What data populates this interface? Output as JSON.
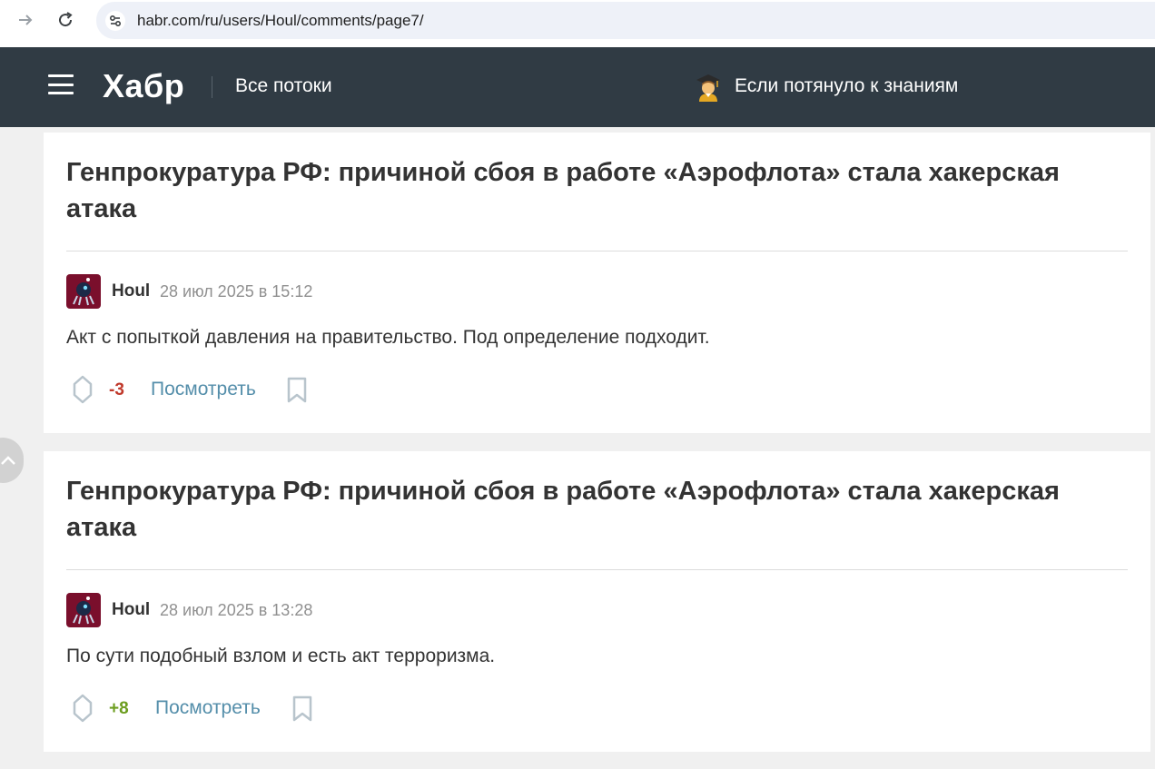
{
  "browser": {
    "url": "habr.com/ru/users/Houl/comments/page7/"
  },
  "header": {
    "logo": "Хабр",
    "streams_label": "Все потоки",
    "promo_text": "Если потянуло к знаниям"
  },
  "comments": [
    {
      "article_title": "Генпрокуратура РФ: причиной сбоя в работе «Аэрофлота» стала хакерская атака",
      "author": "Houl",
      "date": "28 июл 2025 в 15:12",
      "text": "Акт с попыткой давления на правительство. Под определение подходит.",
      "score": "-3",
      "view_label": "Посмотреть"
    },
    {
      "article_title": "Генпрокуратура РФ: причиной сбоя в работе «Аэрофлота» стала хакерская атака",
      "author": "Houl",
      "date": "28 июл 2025 в 13:28",
      "text": "По сути подобный взлом и есть акт терроризма.",
      "score": "+8",
      "view_label": "Посмотреть"
    }
  ],
  "colors": {
    "header_bg": "#303b44",
    "score_negative": "#c0392b",
    "score_positive": "#6c9d1f",
    "link": "#548eaa"
  }
}
